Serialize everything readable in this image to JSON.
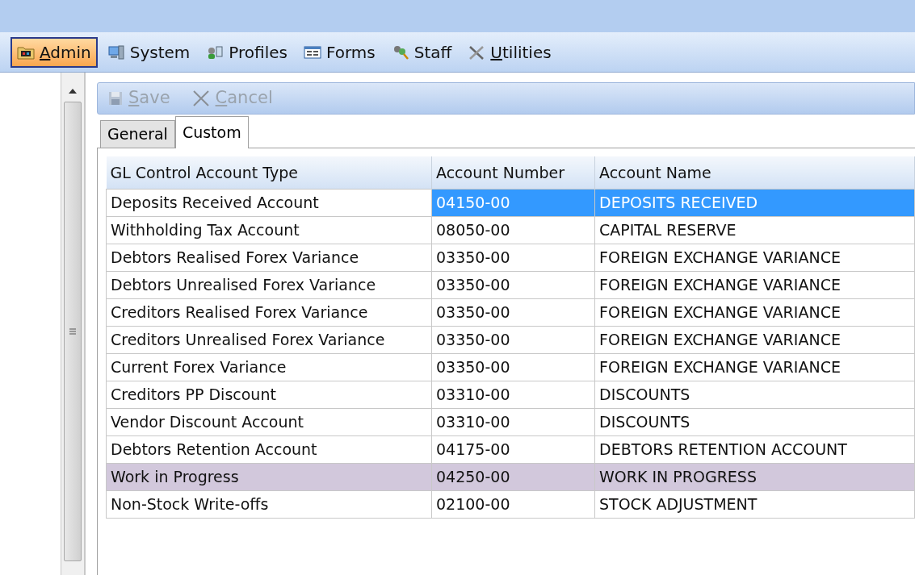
{
  "menu": [
    {
      "label": "Admin",
      "selected": true,
      "mnemonic": true,
      "kind": "folder"
    },
    {
      "label": "System",
      "selected": false,
      "mnemonic": false,
      "kind": "computer"
    },
    {
      "label": "Profiles",
      "selected": false,
      "mnemonic": false,
      "kind": "profiles"
    },
    {
      "label": "Forms",
      "selected": false,
      "mnemonic": false,
      "kind": "form"
    },
    {
      "label": "Staff",
      "selected": false,
      "mnemonic": false,
      "kind": "staff"
    },
    {
      "label": "Utilities",
      "selected": false,
      "mnemonic": true,
      "kind": "tools"
    }
  ],
  "toolbar": [
    {
      "label": "Save",
      "kind": "save",
      "disabled": true
    },
    {
      "label": "Cancel",
      "kind": "cancel",
      "disabled": true
    }
  ],
  "tabs": [
    {
      "label": "General",
      "selected": false
    },
    {
      "label": "Custom",
      "selected": true
    }
  ],
  "table": {
    "columns": [
      "GL Control Account Type",
      "Account Number",
      "Account Name"
    ],
    "rows": [
      {
        "cells": [
          "Deposits Received Account",
          "04150-00",
          "DEPOSITS RECEIVED"
        ],
        "selected": true,
        "hovered": false
      },
      {
        "cells": [
          "Withholding Tax Account",
          "08050-00",
          "CAPITAL RESERVE"
        ],
        "selected": false,
        "hovered": false
      },
      {
        "cells": [
          "Debtors Realised Forex Variance",
          "03350-00",
          "FOREIGN EXCHANGE VARIANCE"
        ],
        "selected": false,
        "hovered": false
      },
      {
        "cells": [
          "Debtors Unrealised Forex Variance",
          "03350-00",
          "FOREIGN EXCHANGE VARIANCE"
        ],
        "selected": false,
        "hovered": false
      },
      {
        "cells": [
          "Creditors Realised Forex Variance",
          "03350-00",
          "FOREIGN EXCHANGE VARIANCE"
        ],
        "selected": false,
        "hovered": false
      },
      {
        "cells": [
          "Creditors Unrealised Forex Variance",
          "03350-00",
          "FOREIGN EXCHANGE VARIANCE"
        ],
        "selected": false,
        "hovered": false
      },
      {
        "cells": [
          "Current Forex Variance",
          "03350-00",
          "FOREIGN EXCHANGE VARIANCE"
        ],
        "selected": false,
        "hovered": false
      },
      {
        "cells": [
          "Creditors PP Discount",
          "03310-00",
          "DISCOUNTS"
        ],
        "selected": false,
        "hovered": false
      },
      {
        "cells": [
          "Vendor Discount Account",
          "03310-00",
          "DISCOUNTS"
        ],
        "selected": false,
        "hovered": false
      },
      {
        "cells": [
          "Debtors Retention Account",
          "04175-00",
          "DEBTORS RETENTION ACCOUNT"
        ],
        "selected": false,
        "hovered": false
      },
      {
        "cells": [
          "Work in Progress",
          "04250-00",
          "WORK IN PROGRESS"
        ],
        "selected": false,
        "hovered": true
      },
      {
        "cells": [
          "Non-Stock Write-offs",
          "02100-00",
          "STOCK ADJUSTMENT"
        ],
        "selected": false,
        "hovered": false
      }
    ]
  }
}
